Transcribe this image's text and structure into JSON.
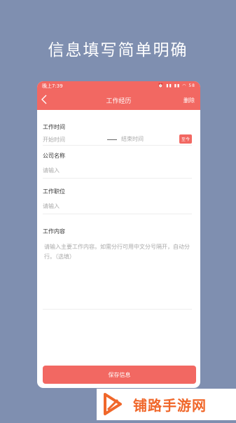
{
  "headline": "信息填写简单明确",
  "status_bar": {
    "time": "晚上7:39",
    "icons": "⏰ ▮▮ ▮▮ ◠ 58"
  },
  "nav": {
    "back_icon": "chevron-left-icon",
    "title": "工作经历",
    "action": "删除"
  },
  "form": {
    "time": {
      "label": "工作时间",
      "start_placeholder": "开始时间",
      "end_placeholder": "结束时间",
      "today_button": "至今"
    },
    "company": {
      "label": "公司名称",
      "placeholder": "请输入"
    },
    "position": {
      "label": "工作职位",
      "placeholder": "请输入"
    },
    "content": {
      "label": "工作内容",
      "placeholder": "请输入主要工作内容。如需分行可用中文分号隔开，自动分行。（选填）"
    }
  },
  "save_button": "保存信息",
  "watermark": {
    "text": "铺路手游网"
  },
  "colors": {
    "accent": "#f26862",
    "background": "#7f8fb0",
    "watermark": "#f0672a"
  }
}
